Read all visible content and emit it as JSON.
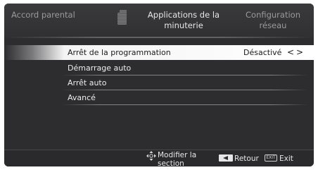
{
  "tabs": {
    "left": "Accord parental",
    "center": "Applications de la minuterie",
    "right": "Configuration réseau"
  },
  "menu": {
    "items": [
      {
        "label": "Arrêt de la programmation",
        "value": "Désactivé",
        "selected": true
      },
      {
        "label": "Démarrage auto"
      },
      {
        "label": "Arrêt auto"
      },
      {
        "label": "Avancé"
      }
    ],
    "arrows": "<>"
  },
  "footer": {
    "modify": "Modifier la section",
    "back": "Retour",
    "exit_key": "EXIT",
    "exit": "Exit"
  },
  "colors": {
    "background": "#2d2d2f",
    "selected_row": "#ffffff",
    "text": "#ececec"
  },
  "icons": [
    "timer-icon",
    "dpad-icon",
    "back-key-icon",
    "exit-key-icon"
  ]
}
